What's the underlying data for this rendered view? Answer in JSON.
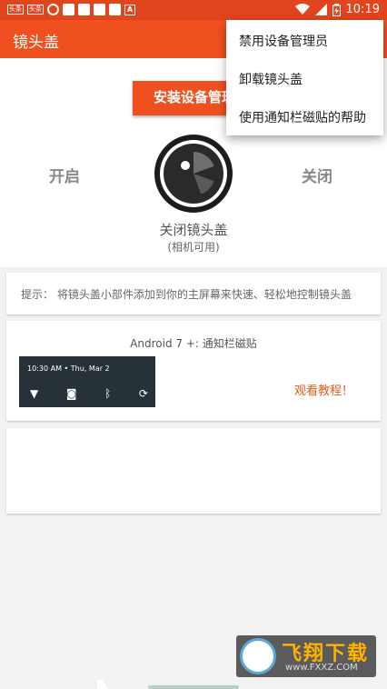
{
  "status_bar": {
    "badge1": "头条",
    "badge2": "头条",
    "a_icon": "A",
    "time": "10:19",
    "icons": [
      "wifi-icon",
      "signal-icon",
      "battery-icon"
    ]
  },
  "app_bar": {
    "title": "镜头盖"
  },
  "main": {
    "install_label": "安装设备管理员",
    "open_label": "开启",
    "close_label": "关闭",
    "state": "关闭镜头盖",
    "state_sub": "(相机可用)"
  },
  "hint": {
    "text": "提示： 将镜头盖小部件添加到你的主屏幕来快速、轻松地控制镜头盖"
  },
  "tile": {
    "title": "Android 7 +: 通知栏磁贴",
    "preview_time": "10:30 AM • Thu, Mar 2",
    "tutorial": "观看教程！"
  },
  "menu": {
    "items": [
      "禁用设备管理员",
      "卸载镜头盖",
      "使用通知栏磁贴的帮助"
    ]
  },
  "watermark": {
    "brand": "飞翔下载",
    "url": "www.FXXZ.COM"
  },
  "colors": {
    "primary": "#f0501f",
    "status": "#e0451d",
    "accent_text": "#e65a1c"
  }
}
